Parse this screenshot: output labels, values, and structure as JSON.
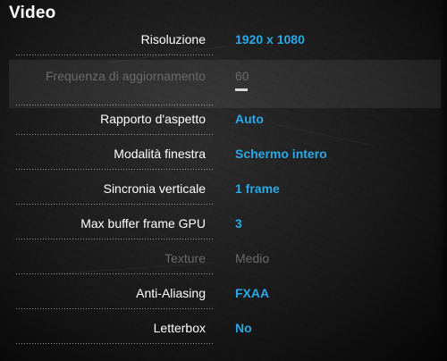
{
  "menu": {
    "title": "Video",
    "settings": [
      {
        "label": "Risoluzione",
        "value": "1920 x 1080",
        "enabled": true
      },
      {
        "label": "Frequenza di aggiornamento",
        "value": "60",
        "enabled": false
      },
      {
        "label": "Rapporto d'aspetto",
        "value": "Auto",
        "enabled": true
      },
      {
        "label": "Modalità finestra",
        "value": "Schermo intero",
        "enabled": true
      },
      {
        "label": "Sincronia verticale",
        "value": "1 frame",
        "enabled": true
      },
      {
        "label": "Max buffer frame GPU",
        "value": "3",
        "enabled": true
      },
      {
        "label": "Texture",
        "value": "Medio",
        "enabled": false
      },
      {
        "label": "Anti-Aliasing",
        "value": "FXAA",
        "enabled": true
      },
      {
        "label": "Letterbox",
        "value": "No",
        "enabled": true
      }
    ]
  },
  "colors": {
    "value_active": "#2aa8e8",
    "label_active": "#ffffff",
    "disabled": "#6a6a6a",
    "selection_highlight": "rgba(255,255,255,0.07)"
  }
}
